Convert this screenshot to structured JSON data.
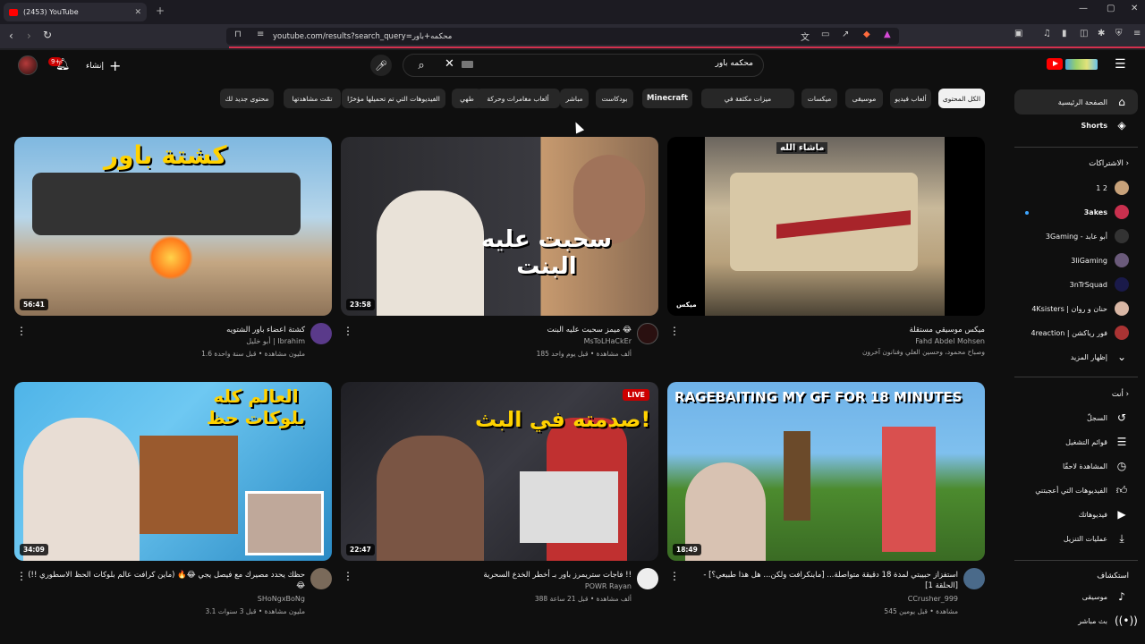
{
  "browser": {
    "tab_title": "(2453) YouTube",
    "url": "youtube.com/results?search_query=محكمه+باور"
  },
  "header": {
    "notifications_badge": "9+",
    "create_label": "إنشاء",
    "search_query": "محكمه باور"
  },
  "chips": [
    "الكل المحتوى",
    "ألعاب فيديو",
    "موسيقى",
    "ميكسات",
    "ميزات مكثفة في",
    "Minecraft",
    "بودكاست",
    "Minecraft",
    "مباشر",
    "ألعاب مغامرات وحركة",
    "طهي",
    "الفيديوهات التي تم تحميلها مؤخرًا",
    "تمّت مشاهدتها",
    "محتوى جديد لك"
  ],
  "sidebar": {
    "home": "الصفحة الرئيسية",
    "shorts": "Shorts",
    "subscriptions_title": "الاشتراكات",
    "subscriptions": [
      "1 2",
      "3akes",
      "3Gaming - أبو عابد",
      "3liGaming",
      "3nTrSquad",
      "4Ksisters | حنان و روان",
      "4reaction | فور رياكشن"
    ],
    "show_more": "إظهار المزيد",
    "you_title": "أنت",
    "you_items": [
      "السجلّ",
      "قوائم التشغيل",
      "المشاهدة لاحقًا",
      "الفيديوهات التي أعجبتني",
      "فيديوهاتك",
      "عمليات التنزيل"
    ],
    "explore_title": "استكشاف",
    "explore_items": [
      "موسيقى",
      "بث مباشر"
    ]
  },
  "videos": [
    {
      "title": "ميكس موسيقي مستقلة",
      "channel": "Fahd Abdel Mohsen",
      "stats": "وصباح محمود، وحسين العلي وفنانون آخرون",
      "duration": "ميكس",
      "thumb_text": "ماشاء الله"
    },
    {
      "title": "ميمز سحبت عليه البنت 😂",
      "channel": "MsToLHaCkEr",
      "stats": "185 ألف مشاهدة • قبل يوم واحد",
      "duration": "23:58",
      "thumb_text": "سحبت عليه البنت"
    },
    {
      "title": "كشتة اعضاء باور الشتويه",
      "channel": "أبو خليل | Ibrahim",
      "stats": "1.6 مليون مشاهدة • قبل سنة واحدة",
      "duration": "56:41",
      "thumb_text": "كشتة باور"
    },
    {
      "title": "استفزاز حبيبتي لمدة 18 دقيقة متواصلة... [ماينكرافت ولكن... هل هذا طبيعي؟] - [الحلقة 1]",
      "channel": "CCrusher_999",
      "stats": "545 مشاهدة • قبل يومين",
      "duration": "18:49",
      "thumb_text": "RAGEBAITING MY GF FOR 18 MINUTES"
    },
    {
      "title": "فاجات ستريمرز باور بـ أخطر الخدع السحرية !!",
      "channel": "POWR Rayan",
      "stats": "388 ألف مشاهدة • قبل 21 ساعة",
      "duration": "22:47",
      "thumb_text": "صدمته في البث!"
    },
    {
      "title": "حظك يحدد مصيرك مع فيصل يجي 😂🔥 (ماين كرافت عالم بلوكات الحظ الاسطوري !!) 😂",
      "channel": "SHoNgxBoNg",
      "stats": "3.1 مليون مشاهدة • قبل 3 سنوات",
      "duration": "34:09",
      "thumb_text": "العالم كله بلوكات حظ"
    }
  ],
  "badge_live": "LIVE",
  "colors": {
    "accent": "#ff0000",
    "bg": "#0f0f0f",
    "chip": "#272727",
    "url_underline": "#d4304e"
  }
}
